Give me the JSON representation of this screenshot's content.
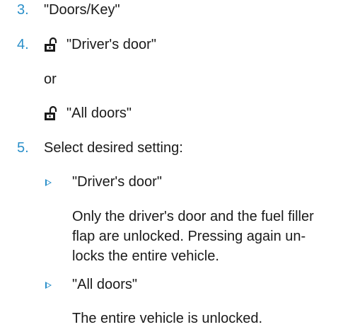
{
  "steps": [
    {
      "number": "3.",
      "text": "\"Doors/Key\""
    },
    {
      "number": "4.",
      "text": "\"Driver's door\"",
      "icon": "unlock-icon"
    },
    {
      "or_text": "or"
    },
    {
      "text": "\"All doors\"",
      "icon": "unlock-icon"
    },
    {
      "number": "5.",
      "text": "Select desired setting:"
    }
  ],
  "options": [
    {
      "label": "\"Driver's door\"",
      "description": [
        "Only the driver's door and the fuel filler",
        "flap are unlocked. Pressing again un-",
        "locks the entire vehicle."
      ]
    },
    {
      "label": "\"All doors\"",
      "description": [
        "The entire vehicle is unlocked."
      ]
    }
  ],
  "colors": {
    "accent": "#2a8fc9",
    "text": "#1a1a1a"
  }
}
